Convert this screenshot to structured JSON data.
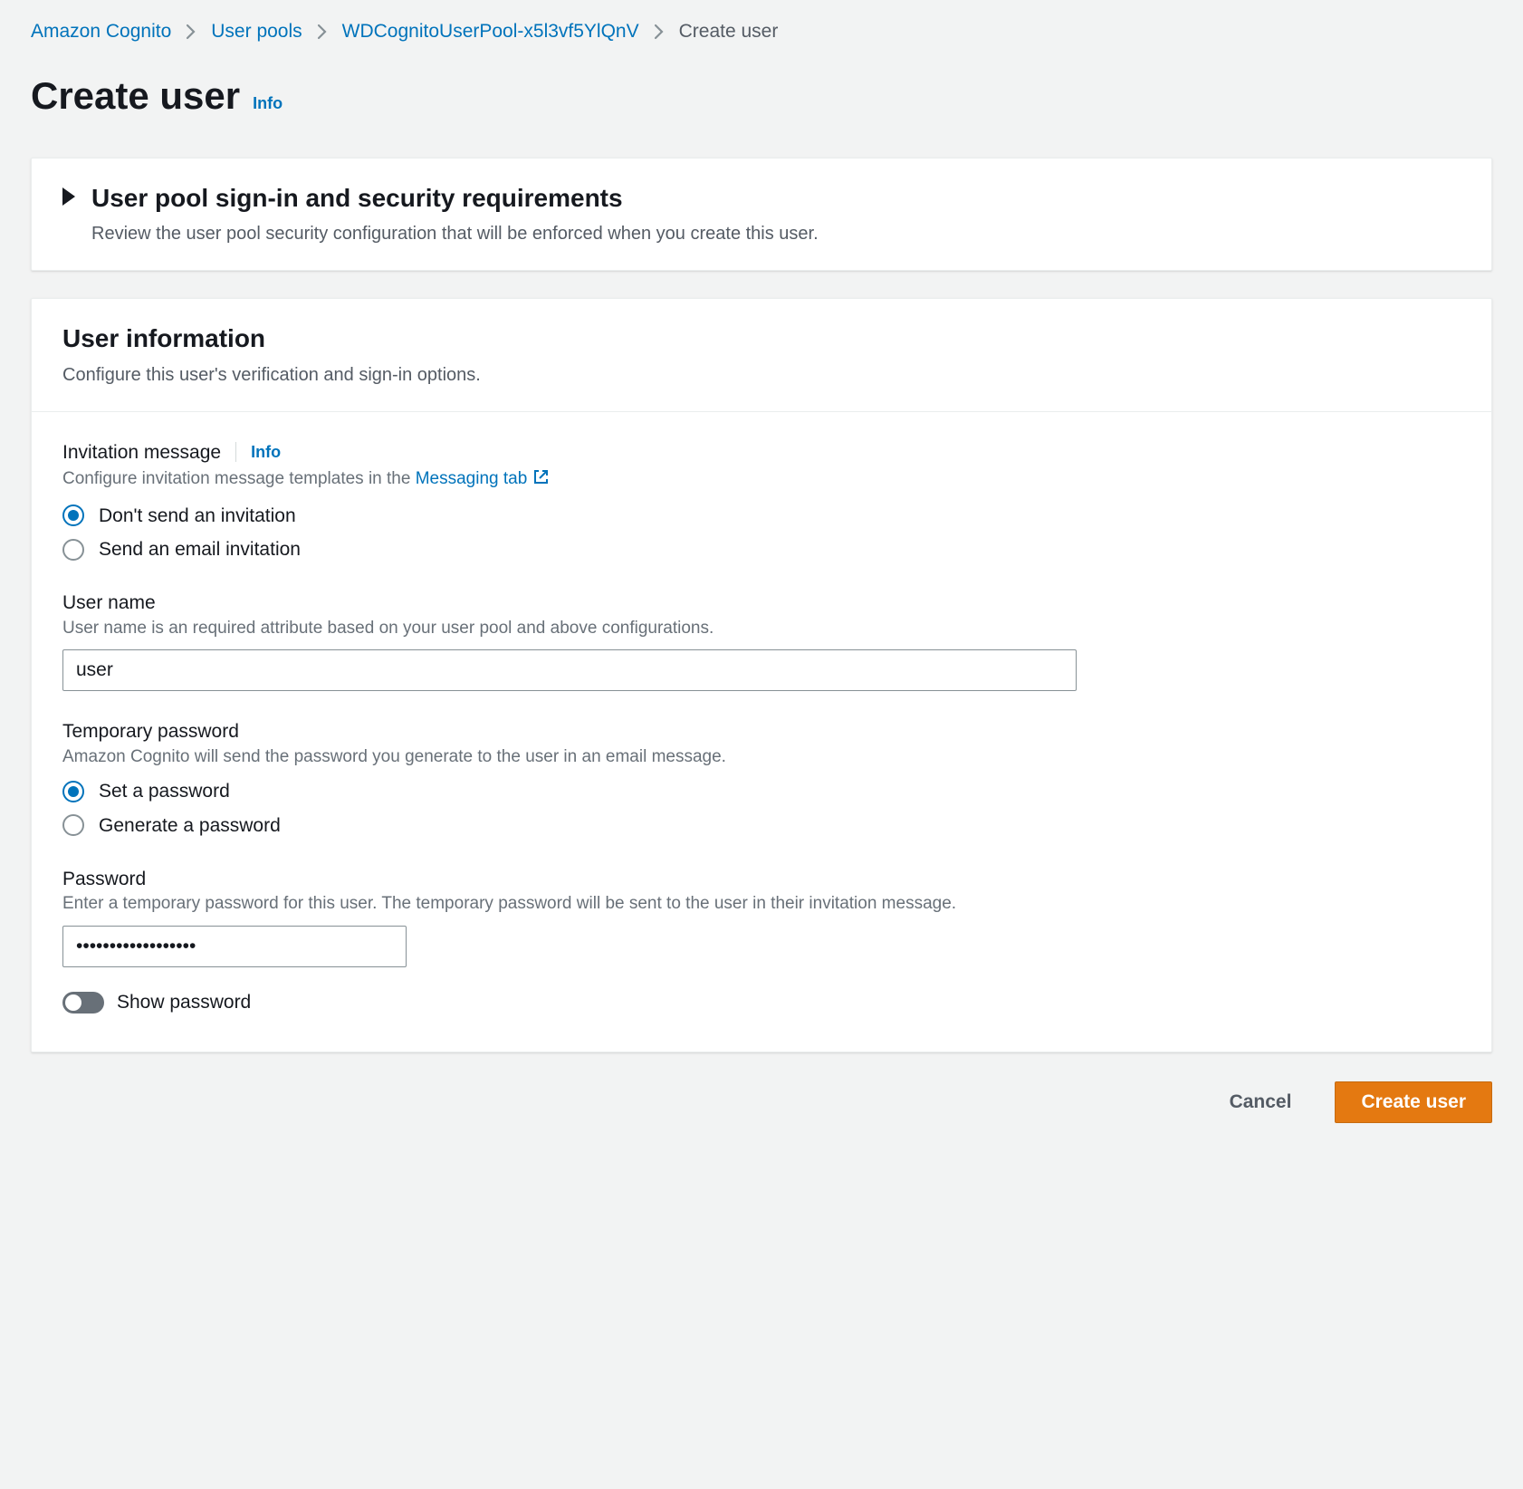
{
  "breadcrumb": {
    "items": [
      {
        "label": "Amazon Cognito",
        "href": true
      },
      {
        "label": "User pools",
        "href": true
      },
      {
        "label": "WDCognitoUserPool-x5l3vf5YlQnV",
        "href": true
      },
      {
        "label": "Create user",
        "href": false
      }
    ]
  },
  "page": {
    "title": "Create user",
    "info": "Info"
  },
  "signinPanel": {
    "title": "User pool sign-in and security requirements",
    "sub": "Review the user pool security configuration that will be enforced when you create this user."
  },
  "userInfoPanel": {
    "title": "User information",
    "sub": "Configure this user's verification and sign-in options.",
    "invitation": {
      "label": "Invitation message",
      "info": "Info",
      "help_prefix": "Configure invitation message templates in the ",
      "help_link": "Messaging tab",
      "options": [
        {
          "label": "Don't send an invitation",
          "checked": true
        },
        {
          "label": "Send an email invitation",
          "checked": false
        }
      ]
    },
    "username": {
      "label": "User name",
      "help": "User name is an required attribute based on your user pool and above configurations.",
      "value": "user"
    },
    "tempPassword": {
      "label": "Temporary password",
      "help": "Amazon Cognito will send the password you generate to the user in an email message.",
      "options": [
        {
          "label": "Set a password",
          "checked": true
        },
        {
          "label": "Generate a password",
          "checked": false
        }
      ]
    },
    "password": {
      "label": "Password",
      "help": "Enter a temporary password for this user. The temporary password will be sent to the user in their invitation message.",
      "value": "••••••••••••••••••"
    },
    "showPassword": {
      "label": "Show password",
      "on": false
    }
  },
  "footer": {
    "cancel": "Cancel",
    "create": "Create user"
  }
}
